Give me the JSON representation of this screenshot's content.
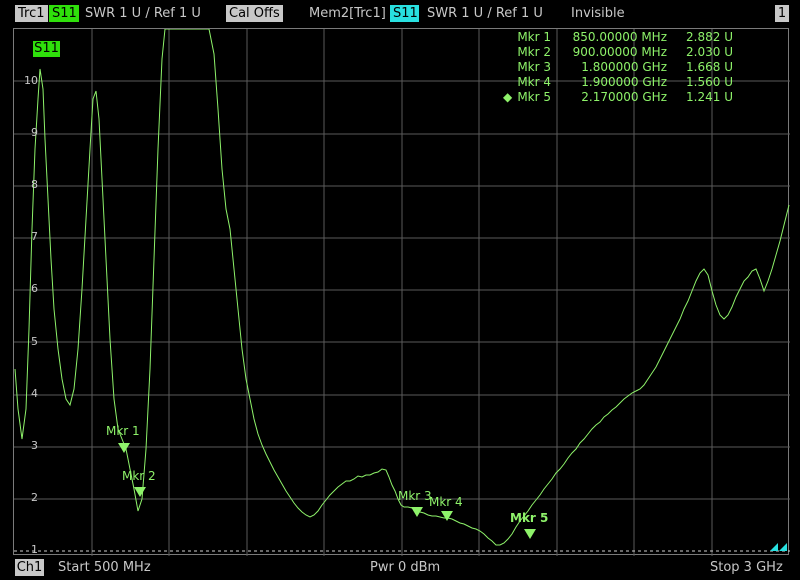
{
  "header": {
    "trace_name": "Trc1",
    "param": "S11",
    "format_scale": "SWR  1 U /  Ref 1 U",
    "cal_status": "Cal Offs",
    "memory_trace": "Mem2[Trc1]",
    "mem_param": "S11",
    "mem_format_scale": "SWR  1 U /  Ref 1 U",
    "mem_visibility": "Invisible",
    "diagram_number": "1"
  },
  "trace_tag": "S11",
  "y_axis_labels": [
    "10",
    "9",
    "8",
    "7",
    "6",
    "5",
    "4",
    "3",
    "2",
    "1"
  ],
  "markers": [
    {
      "name": "Mkr 1",
      "stimulus": "850.00000 MHz",
      "response": "2.882 U",
      "active": false
    },
    {
      "name": "Mkr 2",
      "stimulus": "900.00000 MHz",
      "response": "2.030 U",
      "active": false
    },
    {
      "name": "Mkr 3",
      "stimulus": "1.800000 GHz",
      "response": "1.668 U",
      "active": false
    },
    {
      "name": "Mkr 4",
      "stimulus": "1.900000 GHz",
      "response": "1.560 U",
      "active": false
    },
    {
      "name": "Mkr 5",
      "stimulus": "2.170000 GHz",
      "response": "1.241 U",
      "active": true
    }
  ],
  "trace_marker_labels": {
    "m1": "Mkr 1",
    "m2": "Mkr 2",
    "m3": "Mkr 3",
    "m4": "Mkr 4",
    "m5": "Mkr 5"
  },
  "footer": {
    "channel": "Ch1",
    "start": "Start  500 MHz",
    "power": "Pwr  0 dBm",
    "stop": "Stop  3 GHz"
  },
  "colors": {
    "trace": "#8ef26a",
    "grid": "#5a5a5a",
    "s11_tag": "#2fe00b",
    "mem_tag": "#28e0e0"
  }
}
